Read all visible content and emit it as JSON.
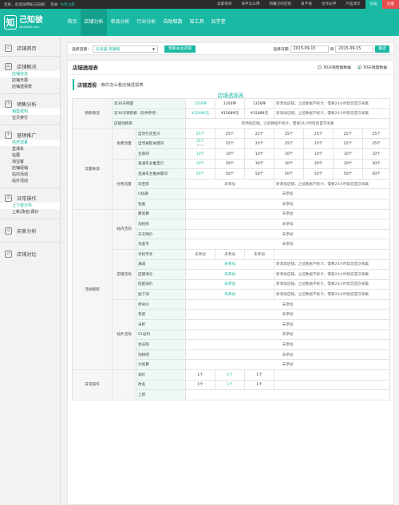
{
  "topbar": {
    "greeting": "您好，欢迎试用知己知彼！",
    "login_link": "登录",
    "register_link": "免费注册",
    "links": [
      "卖家榜单",
      "商手怎么用",
      "和魔方的区别",
      "值不值",
      "合作伙伴",
      "产品演示"
    ],
    "login": "论坛",
    "register": "注册"
  },
  "header": {
    "logo_mark": "知",
    "logo_name": "己知彼",
    "logo_url": "zhibi360.com",
    "nav": [
      "首页",
      "店铺分析",
      "单品分析",
      "行业分析",
      "自助取数",
      "知工具",
      "知学堂"
    ],
    "active_nav": 1
  },
  "sidebar": {
    "groups": [
      {
        "icon": "home-icon",
        "glyph": "⌂",
        "title": "店铺首页",
        "items": []
      },
      {
        "icon": "overview-icon",
        "glyph": "▤",
        "title": "店铺概况",
        "items": [
          {
            "label": "店铺信息",
            "hl": true
          },
          {
            "label": "店铺日报"
          },
          {
            "label": "店铺透视表"
          }
        ]
      },
      {
        "icon": "sales-icon",
        "glyph": "◔",
        "title": "销售分析",
        "items": [
          {
            "label": "销售结构",
            "hl": true
          },
          {
            "label": "宝贝排行"
          }
        ]
      },
      {
        "icon": "promotion-icon",
        "glyph": "✦",
        "title": "营销推广",
        "items": [
          {
            "label": "自然流量",
            "hl": true
          },
          {
            "label": "直通车"
          },
          {
            "label": "钻展"
          },
          {
            "label": "淘宝客"
          },
          {
            "label": "店铺促销"
          },
          {
            "label": "站内活动"
          },
          {
            "label": "站外活动"
          }
        ]
      },
      {
        "icon": "daily-icon",
        "glyph": "☰",
        "title": "日常操作",
        "items": [
          {
            "label": "上下架分布",
            "hl": true
          },
          {
            "label": "上新/改名/调价"
          }
        ]
      },
      {
        "icon": "buyer-icon",
        "glyph": "☺",
        "title": "买家分析",
        "items": []
      },
      {
        "icon": "compare-icon",
        "glyph": "⇄",
        "title": "店铺对比",
        "items": []
      }
    ]
  },
  "filter": {
    "store_label": "选择店铺：",
    "store_value": "乐淘里 高跟鞋",
    "follow_btn": "我要关注店铺",
    "date_label": "选择日期",
    "date_from": "2015-09-15",
    "date_sep": "到",
    "date_to": "2015-09-15",
    "confirm": "确定"
  },
  "panel": {
    "title": "店铺透视表",
    "radio_a": "30天销售额数据",
    "radio_b": "30天销量数据",
    "sub_title": "店铺透视",
    "sub_tip": "- 教你怎么看店铺透视表",
    "table_title": "店铺透视表"
  },
  "table": {
    "sales": {
      "cat": "销售情况",
      "r1": {
        "item": "近30天销量",
        "v": [
          "1356件",
          "1356件",
          "1356件"
        ],
        "note": "新添加店铺，之前数据不统计，需要24小时帮您首次采集"
      },
      "r2": {
        "item": "近30天销售额（仅供参考）",
        "v": [
          "¥15689元",
          "¥15689元",
          "¥15689元"
        ],
        "note": "新添加店铺，之前数据不统计，需要24小时帮您首次采集"
      },
      "r3": {
        "item": "店铺动销率",
        "note": "新添加店铺，之前数据不统计，需要24小时帮您首次采集"
      }
    },
    "traffic": {
      "cat": "流量来源",
      "free": "免费流量",
      "r1": {
        "item": "自然引流宝贝",
        "v": [
          "25个",
          "25个",
          "25个",
          "25个",
          "25个",
          "25个",
          "25个"
        ]
      },
      "r2": {
        "item": "自然展现关键词",
        "v": [
          "25个",
          "25个",
          "25个",
          "25个",
          "25个",
          "25个",
          "25个"
        ],
        "mini": "271 lk"
      },
      "r3": {
        "item": "豆腐块",
        "v": [
          "10个",
          "10个",
          "10个",
          "10个",
          "10个",
          "10个",
          "10个"
        ]
      },
      "paid": "付费流量",
      "r4": {
        "item": "直通车主推宝贝",
        "v": [
          "30个",
          "30个",
          "30个",
          "30个",
          "30个",
          "30个",
          "30个"
        ]
      },
      "r5": {
        "item": "直通车主推关键词",
        "v": [
          "50个",
          "50个",
          "50个",
          "50个",
          "50个",
          "50个",
          "50个"
        ]
      },
      "r6": {
        "item": "淘宝客",
        "na": "未参加",
        "note": "新添加店铺，之前数据不统计，需要24小时帮您首次采集"
      },
      "r7": {
        "item": "U站通",
        "na": "未参加"
      },
      "r8": {
        "item": "钻展",
        "na": "未参加"
      }
    },
    "activity": {
      "cat": "活动跟踪",
      "onsite": "站内活动",
      "onsite_items": [
        "聚划算",
        "淘抢购",
        "天天特价",
        "淘金币"
      ],
      "store": "店铺活动",
      "r_phone": {
        "item": "手机专享",
        "v": [
          "未参加",
          "未参加",
          "未参加"
        ]
      },
      "store_items": [
        "满减",
        "店铺清仓",
        "搭配减价",
        "拍下减"
      ],
      "offsite": "站外活动",
      "offsite_items": [
        "折800",
        "卷皮",
        "米折",
        "51返利",
        "会员购",
        "淘粉吧",
        "众划算"
      ],
      "na": "未参加",
      "note": "新添加店铺，之前数据不统计，需要24小时帮您首次采集"
    },
    "daily": {
      "cat": "日常操作",
      "r1": {
        "item": "调价",
        "v": [
          "1个",
          "1个",
          "1个"
        ]
      },
      "r2": {
        "item": "改名",
        "v": [
          "1个",
          "1个",
          "1个"
        ]
      },
      "r3": {
        "item": "上新"
      }
    }
  }
}
